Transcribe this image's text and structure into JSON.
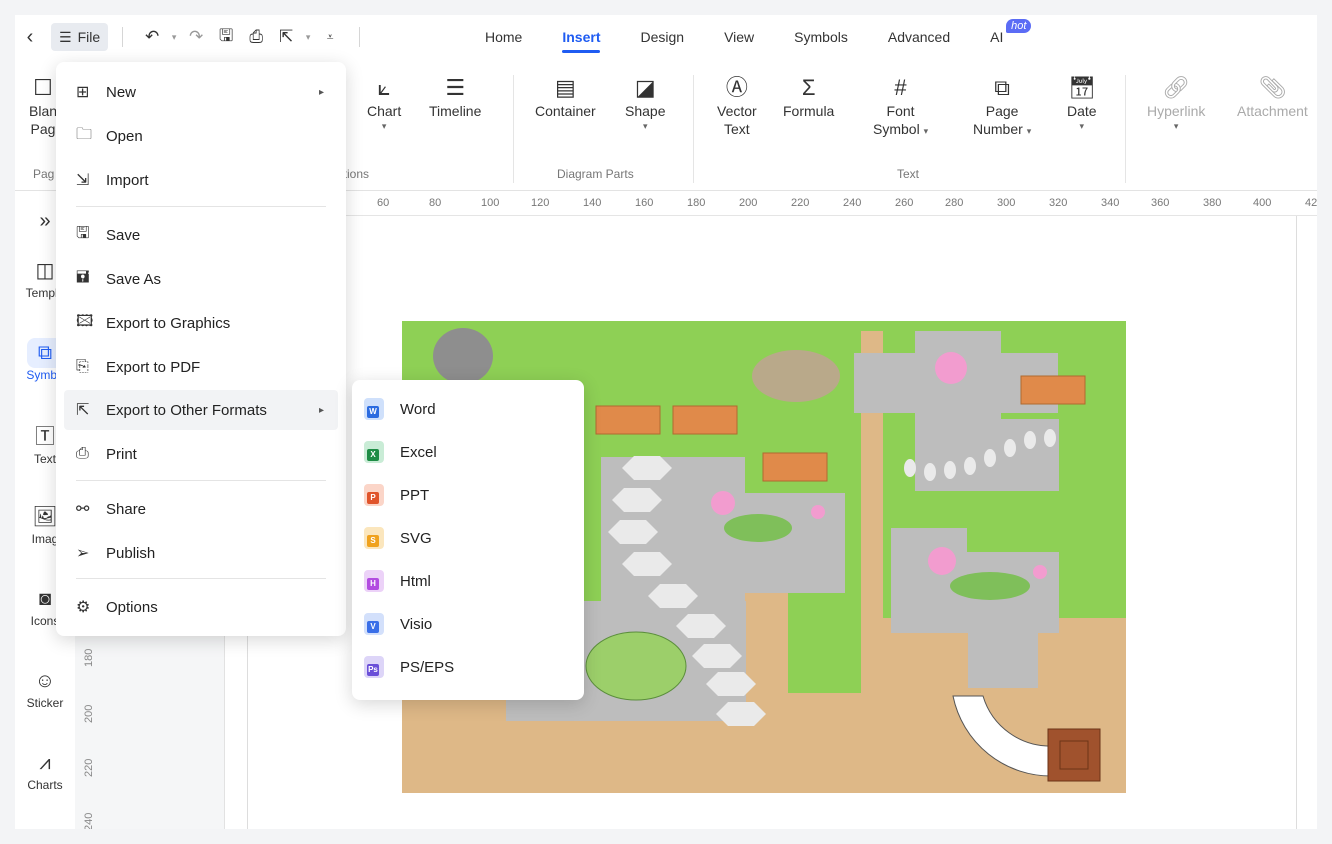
{
  "titlebar": {
    "file_label": "File",
    "tabs": [
      {
        "label": "Home"
      },
      {
        "label": "Insert"
      },
      {
        "label": "Design"
      },
      {
        "label": "View"
      },
      {
        "label": "Symbols"
      },
      {
        "label": "Advanced"
      },
      {
        "label": "AI"
      }
    ],
    "hot_badge": "hot"
  },
  "ribbon": {
    "blank_page": [
      "Blan",
      "Pag"
    ],
    "chart": "Chart",
    "timeline": "Timeline",
    "container": "Container",
    "shape": "Shape",
    "vector_text": [
      "Vector",
      "Text"
    ],
    "formula": "Formula",
    "font_symbol": [
      "Font",
      "Symbol"
    ],
    "page_number": [
      "Page",
      "Number"
    ],
    "date": "Date",
    "hyperlink": "Hyperlink",
    "attachment": "Attachment",
    "groups": {
      "pages": "Pag",
      "illustrations": "rations",
      "diagram_parts": "Diagram Parts",
      "text": "Text"
    }
  },
  "rail": [
    {
      "label": "",
      "icon": "expand-icon"
    },
    {
      "label": "Templa",
      "icon": "template-icon"
    },
    {
      "label": "Symbo",
      "icon": "symbols-icon"
    },
    {
      "label": "Text",
      "icon": "text-icon"
    },
    {
      "label": "Imag",
      "icon": "image-icon"
    },
    {
      "label": "Icons",
      "icon": "icons-icon"
    },
    {
      "label": "Sticker",
      "icon": "sticker-icon"
    },
    {
      "label": "Charts",
      "icon": "charts-icon"
    }
  ],
  "vruler": [
    "180",
    "200",
    "220",
    "240"
  ],
  "hruler": [
    "60",
    "80",
    "100",
    "120",
    "140",
    "160",
    "180",
    "200",
    "220",
    "240",
    "260",
    "280",
    "300",
    "320",
    "340",
    "360",
    "380",
    "400",
    "42"
  ],
  "file_menu": [
    {
      "label": "New"
    },
    {
      "label": "Open"
    },
    {
      "label": "Import"
    },
    {
      "label": "Save"
    },
    {
      "label": "Save As"
    },
    {
      "label": "Export to Graphics"
    },
    {
      "label": "Export to PDF"
    },
    {
      "label": "Export to Other Formats"
    },
    {
      "label": "Print"
    },
    {
      "label": "Share"
    },
    {
      "label": "Publish"
    },
    {
      "label": "Options"
    }
  ],
  "export_submenu": [
    {
      "label": "Word",
      "badge": "W",
      "color": "#2b6be0"
    },
    {
      "label": "Excel",
      "badge": "X",
      "color": "#1e8c45"
    },
    {
      "label": "PPT",
      "badge": "P",
      "color": "#e0542b"
    },
    {
      "label": "SVG",
      "badge": "S",
      "color": "#f0a21e"
    },
    {
      "label": "Html",
      "badge": "H",
      "color": "#b24ce0"
    },
    {
      "label": "Visio",
      "badge": "V",
      "color": "#3a6fe8"
    },
    {
      "label": "PS/EPS",
      "badge": "Ps",
      "color": "#6a4fd8"
    }
  ],
  "colors": {
    "accent": "#1f5cf2",
    "grass": "#8ed055",
    "path": "#deb887",
    "stone": "#bdbdbd"
  }
}
